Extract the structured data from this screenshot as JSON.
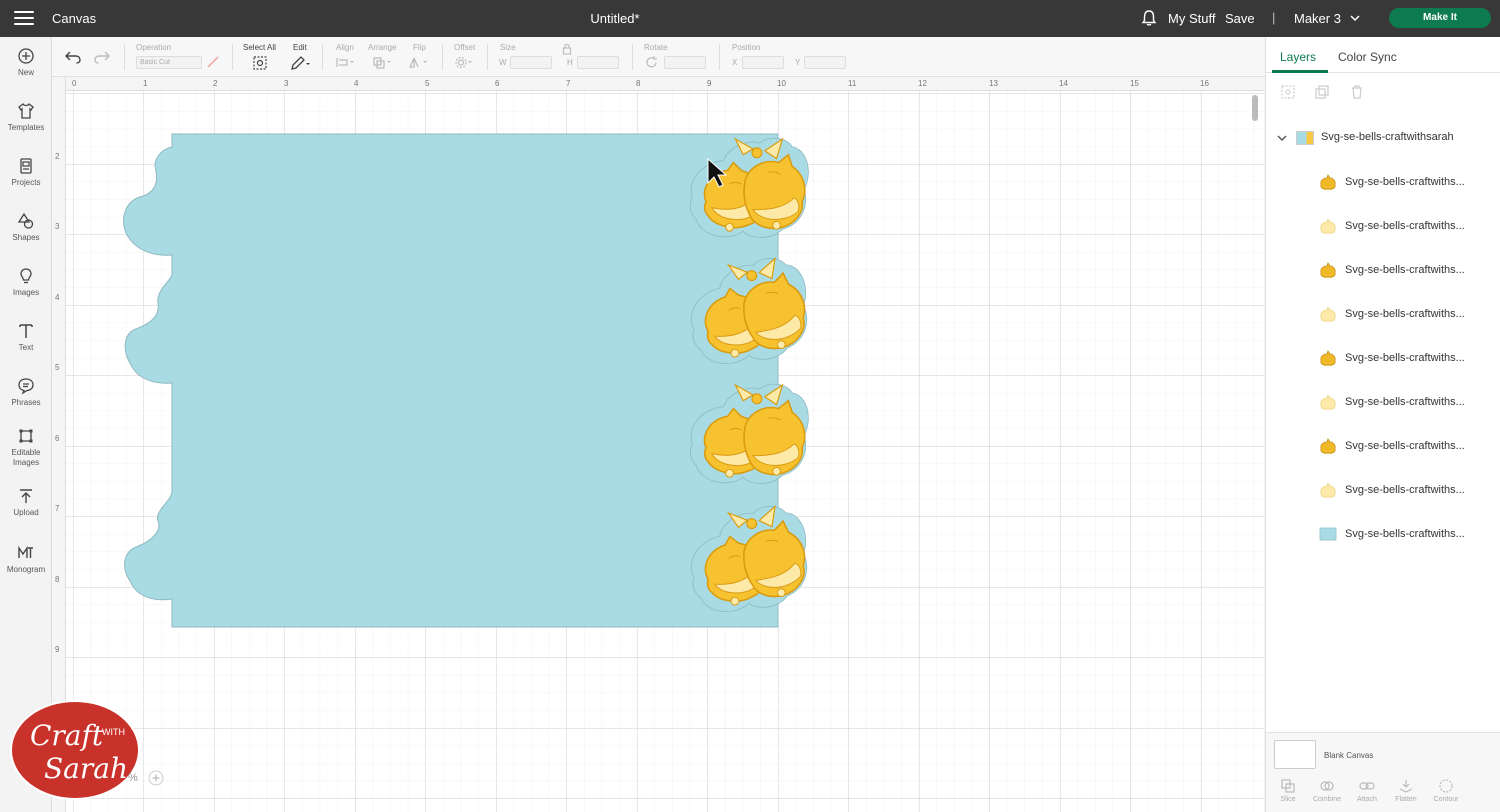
{
  "topbar": {
    "app_name": "Canvas",
    "doc_title": "Untitled*",
    "my_stuff": "My Stuff",
    "save": "Save",
    "separator": "|",
    "machine": "Maker 3",
    "make_it": "Make It"
  },
  "sidebar": {
    "items": [
      {
        "label": "New",
        "icon": "plus-circle-icon"
      },
      {
        "label": "Templates",
        "icon": "shirt-icon"
      },
      {
        "label": "Projects",
        "icon": "projects-icon"
      },
      {
        "label": "Shapes",
        "icon": "shapes-icon"
      },
      {
        "label": "Images",
        "icon": "lightbulb-icon"
      },
      {
        "label": "Text",
        "icon": "text-icon"
      },
      {
        "label": "Phrases",
        "icon": "speech-bubble-icon"
      },
      {
        "label": "Editable\nImages",
        "icon": "editable-images-icon"
      },
      {
        "label": "Upload",
        "icon": "upload-icon"
      },
      {
        "label": "Monogram",
        "icon": "monogram-icon"
      }
    ]
  },
  "toolbar": {
    "operation_label": "Operation",
    "operation_value": "Basic Cut",
    "select_all": "Select All",
    "edit": "Edit",
    "align": "Align",
    "arrange": "Arrange",
    "flip": "Flip",
    "offset": "Offset",
    "size": "Size",
    "w": "W",
    "h": "H",
    "rotate": "Rotate",
    "position": "Position",
    "x": "X",
    "y": "Y"
  },
  "ruler": {
    "top": [
      "0",
      "1",
      "2",
      "3",
      "4",
      "5",
      "6",
      "7",
      "8",
      "9",
      "10",
      "11",
      "12",
      "13",
      "14",
      "15",
      "16"
    ],
    "left": [
      "2",
      "3",
      "4",
      "5",
      "6",
      "7",
      "8",
      "9"
    ]
  },
  "colors": {
    "canvas_shape": "#a8dbe4",
    "bell_gold": "#f7c230",
    "bell_light": "#fde9a8",
    "bell_outline": "#d99b0f",
    "accent": "#0d7a4f",
    "topbar": "#383838"
  },
  "layers_panel": {
    "tab_layers": "Layers",
    "tab_color_sync": "Color Sync",
    "group_name": "Svg-se-bells-craftwithsarah",
    "items": [
      {
        "name": "Svg-se-bells-craftwiths...",
        "thumb": "bell-dark"
      },
      {
        "name": "Svg-se-bells-craftwiths...",
        "thumb": "bell-light"
      },
      {
        "name": "Svg-se-bells-craftwiths...",
        "thumb": "bell-dark"
      },
      {
        "name": "Svg-se-bells-craftwiths...",
        "thumb": "bell-light"
      },
      {
        "name": "Svg-se-bells-craftwiths...",
        "thumb": "bell-dark"
      },
      {
        "name": "Svg-se-bells-craftwiths...",
        "thumb": "bell-light"
      },
      {
        "name": "Svg-se-bells-craftwiths...",
        "thumb": "bell-dark"
      },
      {
        "name": "Svg-se-bells-craftwiths...",
        "thumb": "bell-light"
      },
      {
        "name": "Svg-se-bells-craftwiths...",
        "thumb": "blue-card"
      }
    ],
    "blank_canvas": "Blank Canvas",
    "bottom_tools": [
      "Slice",
      "Combine",
      "Attach",
      "Flatten",
      "Contour"
    ]
  },
  "watermark": {
    "line1": "Craft",
    "with": "WITH",
    "line2": "Sarah"
  },
  "zoom": "%"
}
